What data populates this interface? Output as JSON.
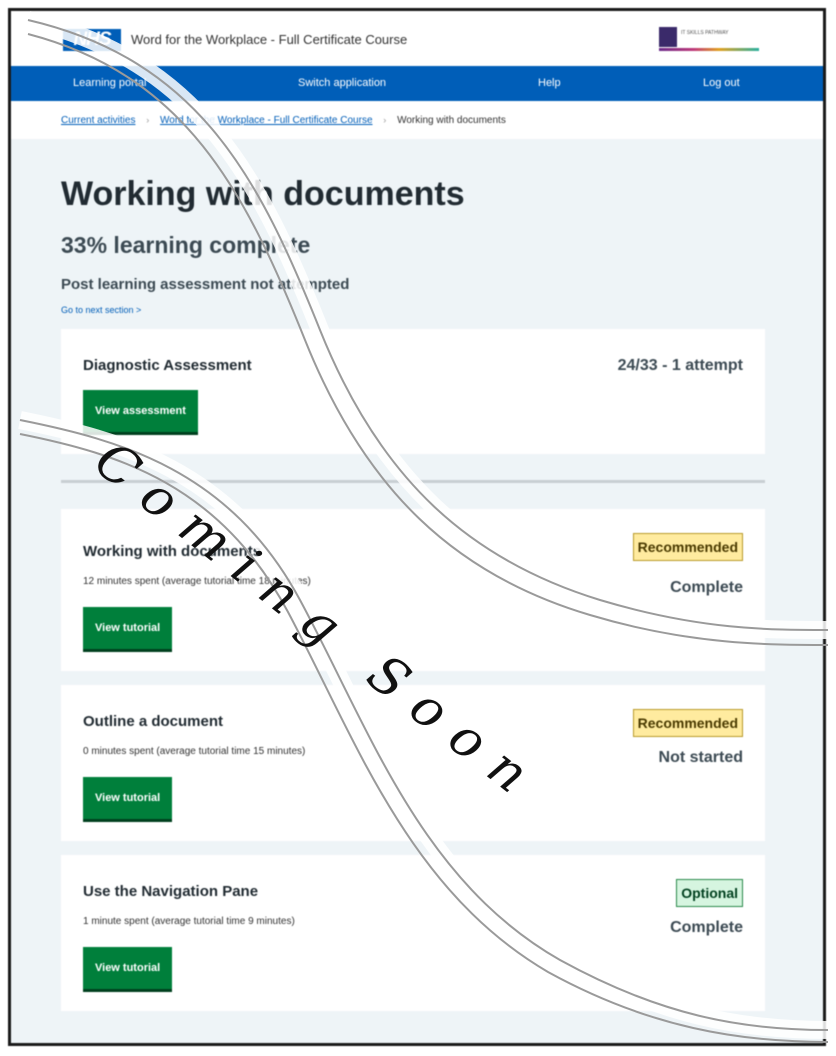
{
  "header": {
    "logo": "NHS",
    "app_title": "Word for the Workplace - Full Certificate Course",
    "partner_logo_text": "IT SKILLS PATHWAY"
  },
  "nav": {
    "items": [
      "Learning portal",
      "Switch application",
      "Help",
      "Log out"
    ]
  },
  "breadcrumb": {
    "items": [
      "Current activities",
      "Word for the Workplace - Full Certificate Course"
    ],
    "current": "Working with documents"
  },
  "page": {
    "title": "Working with documents",
    "progress": "33% learning complete",
    "post_assessment": "Post learning assessment not attempted",
    "next_link": "Go to next section >"
  },
  "diagnostic": {
    "title": "Diagnostic Assessment",
    "score": "24/33 - 1 attempt",
    "button": "View assessment"
  },
  "tutorials": [
    {
      "title": "Working with documents",
      "meta": "12 minutes spent (average tutorial time 18 minutes)",
      "tag": "Recommended",
      "status": "Complete",
      "button": "View tutorial"
    },
    {
      "title": "Outline a document",
      "meta": "0 minutes spent (average tutorial time 15 minutes)",
      "tag": "Recommended",
      "status": "Not started",
      "button": "View tutorial"
    },
    {
      "title": "Use the Navigation Pane",
      "meta": "1 minute spent (average tutorial time 9 minutes)",
      "tag": "Optional",
      "status": "Complete",
      "button": "View tutorial"
    }
  ],
  "watermark": {
    "text": "Coming Soon"
  },
  "colors": {
    "nhs_blue": "#005eb8",
    "button_green": "#007f3b",
    "recommended_bg": "#ffeb9f",
    "optional_bg": "#d6f5e0"
  }
}
